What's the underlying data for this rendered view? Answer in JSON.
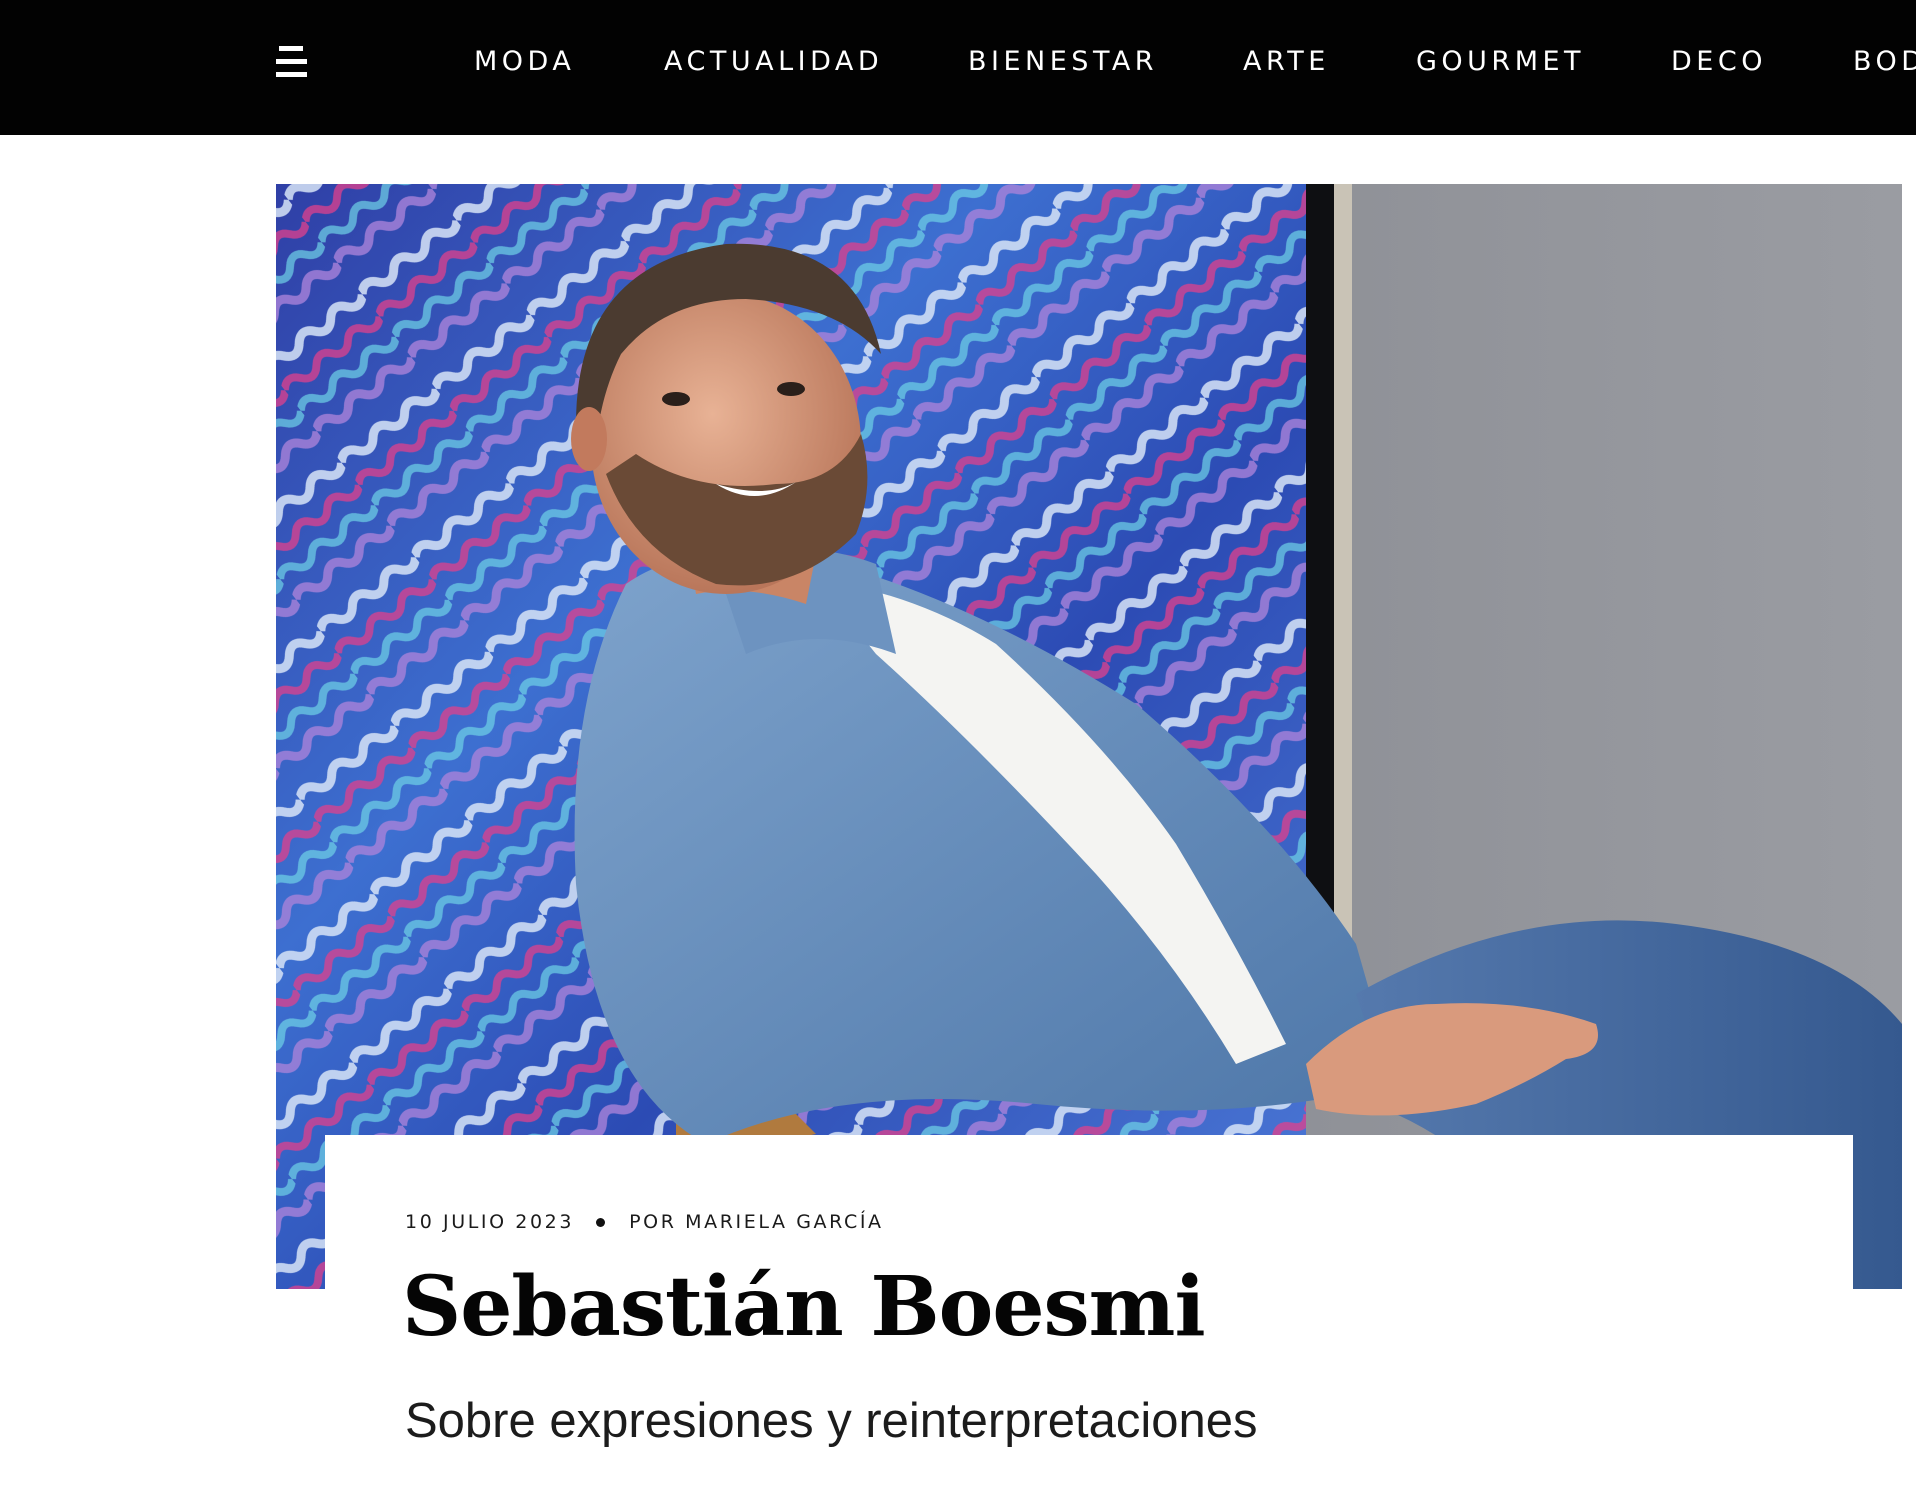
{
  "header": {
    "menu_icon": "hamburger-menu-icon",
    "nav": [
      {
        "label": "MODA"
      },
      {
        "label": "ACTUALIDAD"
      },
      {
        "label": "BIENESTAR"
      },
      {
        "label": "ARTE"
      },
      {
        "label": "GOURMET"
      },
      {
        "label": "DECO"
      },
      {
        "label": "BOD"
      }
    ],
    "background": "#020202",
    "text_color": "#ffffff"
  },
  "article": {
    "date": "10 JULIO 2023",
    "author": "POR MARIELA GARCÍA",
    "title": "Sebastián Boesmi",
    "subtitle": "Sobre expresiones y reinterpretaciones"
  }
}
